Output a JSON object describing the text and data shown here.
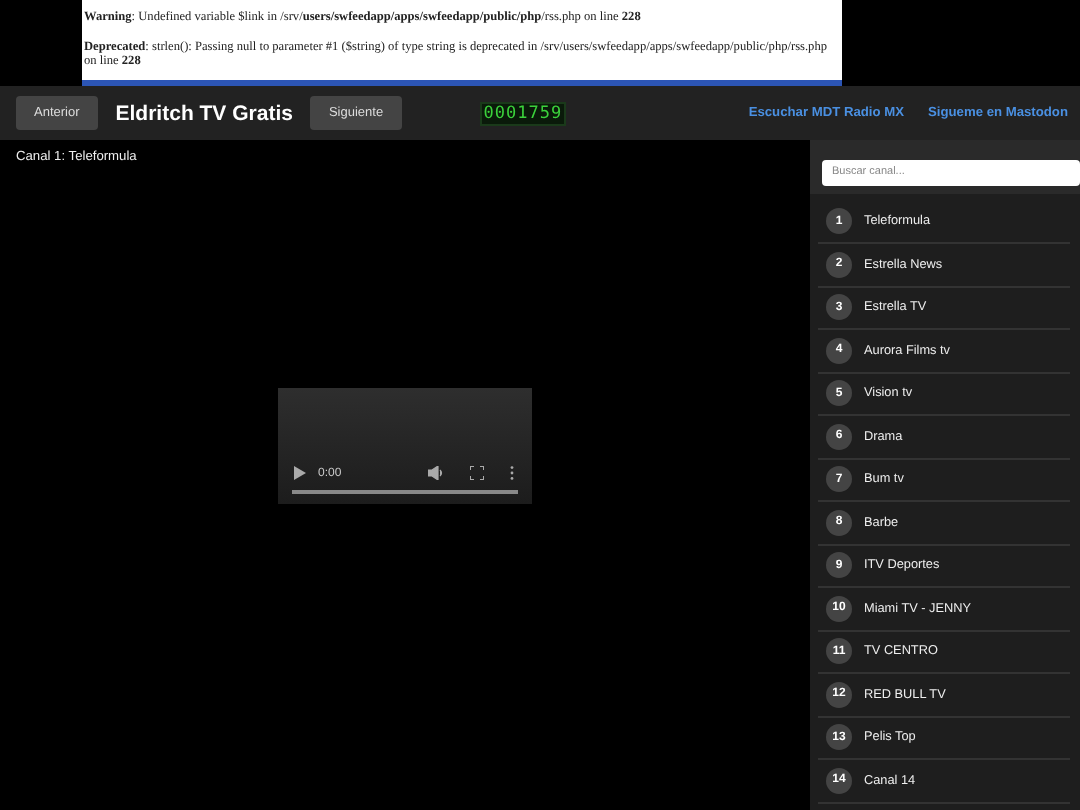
{
  "php_notices": [
    {
      "kind": "warning",
      "label": "Warning",
      "text": ": Undefined variable $link in ",
      "path": "/srv/**users/swfeedapp/apps/swfeedapp/public/php**/rss.php",
      "line_prefix": " on line ",
      "line": "228"
    },
    {
      "kind": "deprecated",
      "label": "Deprecated",
      "text": ": strlen(): Passing null to parameter #1 ($string) of type string is deprecated in ",
      "path": "/srv/users/swfeedapp/apps/swfeedapp/public/php/rss.php",
      "line_prefix": " on line ",
      "line": "228"
    }
  ],
  "header": {
    "prev_button": "Anterior",
    "title": "Eldritch TV Gratis",
    "next_button": "Siguiente",
    "counter": "0001759",
    "links": [
      "Escuchar MDT Radio MX",
      "Sigueme en Mastodon"
    ]
  },
  "now_playing": "Canal 1: Teleformula",
  "video": {
    "time": "0:00"
  },
  "sidebar": {
    "search": {
      "placeholder": "Buscar canal..."
    },
    "channels": [
      {
        "number": "1",
        "name": "Teleformula"
      },
      {
        "number": "2",
        "name": "Estrella News"
      },
      {
        "number": "3",
        "name": "Estrella TV"
      },
      {
        "number": "4",
        "name": "Aurora Films tv"
      },
      {
        "number": "5",
        "name": "Vision tv"
      },
      {
        "number": "6",
        "name": "Drama"
      },
      {
        "number": "7",
        "name": "Bum tv"
      },
      {
        "number": "8",
        "name": "Barbe"
      },
      {
        "number": "9",
        "name": "ITV Deportes"
      },
      {
        "number": "10",
        "name": "Miami TV - JENNY"
      },
      {
        "number": "11",
        "name": "TV CENTRO"
      },
      {
        "number": "12",
        "name": "RED BULL TV"
      },
      {
        "number": "13",
        "name": "Pelis Top"
      },
      {
        "number": "14",
        "name": "Canal 14"
      }
    ]
  }
}
